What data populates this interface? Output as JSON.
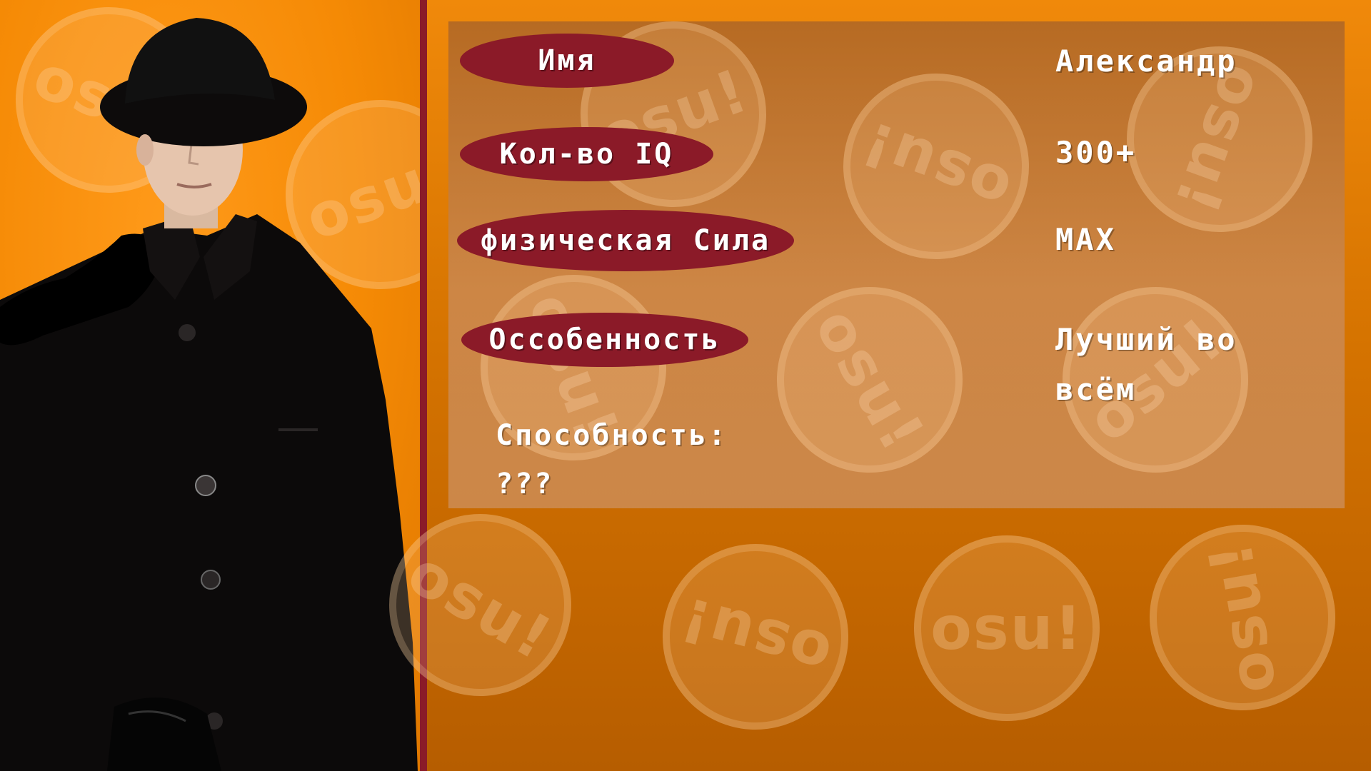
{
  "background": {
    "color": "#e07d05",
    "accent": "#8b1a28",
    "divider_color": "#8a1b28"
  },
  "coins": {
    "left": [
      {
        "label": "osu!"
      },
      {
        "label": "osu!"
      }
    ],
    "card": [
      {
        "label": "osu!"
      },
      {
        "label": "osu!"
      },
      {
        "label": "osu!"
      },
      {
        "label": "osu!"
      },
      {
        "label": "osu!"
      },
      {
        "label": "osu!"
      }
    ],
    "bottom": [
      {
        "label": "osu!"
      },
      {
        "label": "osu!"
      },
      {
        "label": "osu!"
      },
      {
        "label": "osu!"
      }
    ]
  },
  "profile": {
    "labels": {
      "name": "Имя",
      "iq": "Кол-во IQ",
      "strength": "физическая Сила",
      "feature": "Оссобенность"
    },
    "values": {
      "name": "Александр",
      "iq": "300+",
      "strength": "MAX",
      "feature_line1": "Лучший во",
      "feature_line2": "всём"
    },
    "ability": {
      "label": "Способность:",
      "value": "???"
    }
  }
}
